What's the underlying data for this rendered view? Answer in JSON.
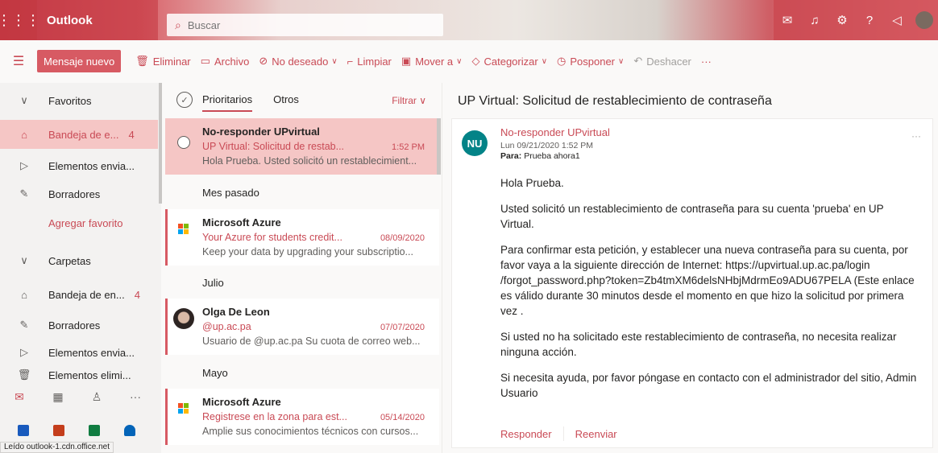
{
  "header": {
    "app_name": "Outlook",
    "search_placeholder": "Buscar"
  },
  "toolbar": {
    "new_message": "Mensaje nuevo",
    "delete": "Eliminar",
    "archive": "Archivo",
    "junk": "No deseado",
    "sweep": "Limpiar",
    "move": "Mover a",
    "categorize": "Categorizar",
    "snooze": "Posponer",
    "undo": "Deshacer"
  },
  "sidebar": {
    "favorites_label": "Favoritos",
    "favorites": [
      {
        "label": "Bandeja de e...",
        "count": "4"
      },
      {
        "label": "Elementos envia..."
      },
      {
        "label": "Borradores"
      }
    ],
    "add_favorite": "Agregar favorito",
    "folders_label": "Carpetas",
    "folders": [
      {
        "label": "Bandeja de en...",
        "count": "4"
      },
      {
        "label": "Borradores"
      },
      {
        "label": "Elementos envia..."
      },
      {
        "label": "Elementos elimi..."
      }
    ]
  },
  "message_list": {
    "tab_focused": "Prioritarios",
    "tab_other": "Otros",
    "filter": "Filtrar",
    "groups": [
      "Mes pasado",
      "Julio",
      "Mayo"
    ],
    "messages": [
      {
        "from": "No-responder UPvirtual",
        "subject": "UP Virtual: Solicitud de restab...",
        "date": "1:52 PM",
        "preview": "Hola Prueba. Usted solicitó un restablecimient..."
      },
      {
        "from": "Microsoft Azure",
        "subject": "Your Azure for students credit...",
        "date": "08/09/2020",
        "preview": "Keep your data by upgrading your subscriptio..."
      },
      {
        "from": "Olga De Leon",
        "subject": "@up.ac.pa",
        "date": "07/07/2020",
        "preview": "Usuario de @up.ac.pa Su cuota de correo web..."
      },
      {
        "from": "Microsoft Azure",
        "subject": "Registrese en la zona para est...",
        "date": "05/14/2020",
        "preview": "Amplie sus conocimientos técnicos con cursos..."
      }
    ]
  },
  "reading_pane": {
    "title": "UP Virtual: Solicitud de restablecimiento de contraseña",
    "avatar_initials": "NU",
    "sender": "No-responder UPvirtual",
    "datetime": "Lun 09/21/2020 1:52 PM",
    "to_label": "Para:",
    "to_value": "Prueba ahora1",
    "more": "···",
    "body": [
      "Hola Prueba.",
      "Usted solicitó un restablecimiento de contraseña para su cuenta 'prueba' en UP Virtual.",
      "Para confirmar esta petición, y establecer una nueva contraseña para su cuenta, por favor vaya a la siguiente dirección de Internet: https://upvirtual.up.ac.pa/login /forgot_password.php?token=Zb4tmXM6delsNHbjMdrmEo9ADU67PELA (Este enlace es válido durante 30 minutos desde el momento en que hizo la solicitud por primera vez .",
      "Si usted no ha solicitado este restablecimiento de contraseña, no necesita realizar ninguna acción.",
      "Si necesita ayuda, por favor póngase en contacto con el administrador del sitio, Admin Usuario"
    ],
    "reply": "Responder",
    "forward": "Reenviar"
  },
  "status_bar": "Leído outlook-1.cdn.office.net",
  "colors": {
    "accent": "#c94a55",
    "selected": "#f5c6c5",
    "avatar": "#038387"
  }
}
